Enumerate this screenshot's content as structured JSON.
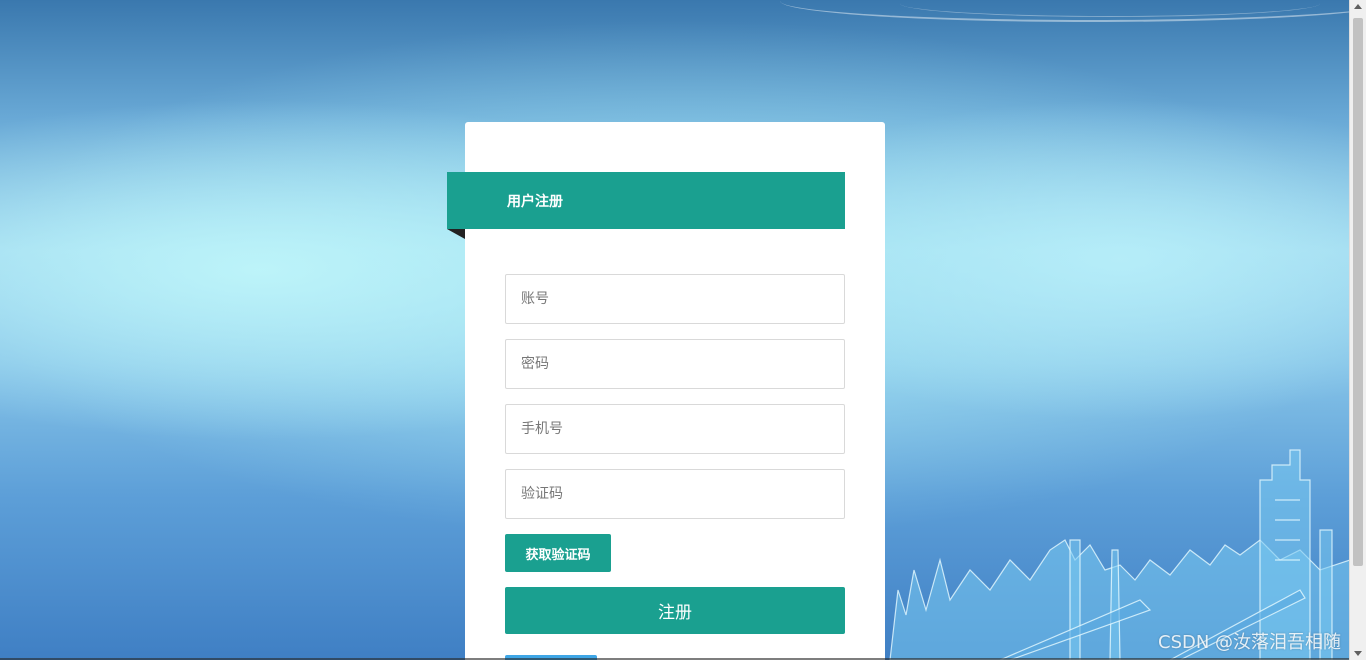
{
  "register_card": {
    "title": "用户注册",
    "account_placeholder": "账号",
    "password_placeholder": "密码",
    "phone_placeholder": "手机号",
    "code_placeholder": "验证码",
    "get_code_label": "获取验证码",
    "register_label": "注册"
  },
  "watermark": "CSDN @汝落泪吾相随",
  "colors": {
    "accent": "#1aa090",
    "secondary_button": "#3ea6e6"
  }
}
